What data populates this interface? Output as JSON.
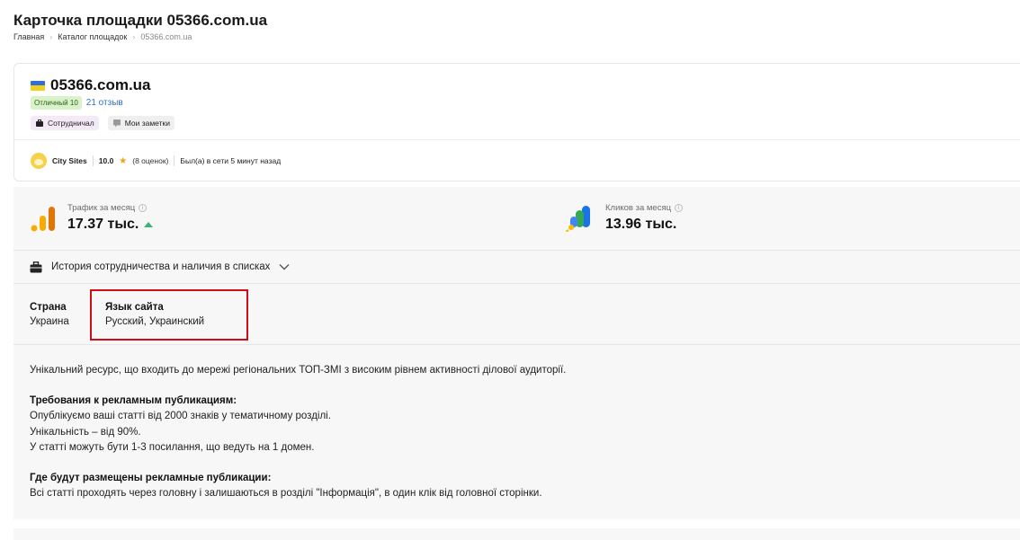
{
  "page": {
    "title": "Карточка площадки 05366.com.ua"
  },
  "breadcrumb": {
    "items": [
      "Главная",
      "Каталог площадок",
      "05366.com.ua"
    ]
  },
  "site": {
    "name": "05366.com.ua",
    "rating_badge": "Отличный 10",
    "reviews": "21 отзыв",
    "tags": {
      "collaborated": "Сотрудничал",
      "notes": "Мои заметки"
    },
    "owner": {
      "name": "City Sites",
      "score": "10.0",
      "votes": "(8 оценок)",
      "online": "Был(а) в сети 5 минут назад"
    }
  },
  "stats": {
    "traffic": {
      "label": "Трафик за месяц",
      "value": "17.37 тыс."
    },
    "clicks": {
      "label": "Кликов за месяц",
      "value": "13.96 тыс."
    }
  },
  "history": {
    "label": "История сотрудничества и наличия в списках"
  },
  "props": {
    "country": {
      "key": "Страна",
      "value": "Украина"
    },
    "language": {
      "key": "Язык сайта",
      "value": "Русский, Украинский"
    }
  },
  "description": {
    "intro": "Унікальний ресурс, що входить до мережі регіональних ТОП-ЗМІ з високим рівнем активності ділової аудиторії.",
    "requirements_heading": "Требования к рекламным публикациям:",
    "requirements": [
      "Опублікуємо ваші статті від 2000 знаків у тематичному розділі.",
      "Унікальність – від 90%.",
      "У статті можуть бути 1-3 посилання, що ведуть на 1 домен."
    ],
    "placement_heading": "Где будут размещены рекламные публикации:",
    "placement": "Всі статті проходять через головну і залишаються в розділі \"Інформація\", в один клік від головної сторінки."
  },
  "colors": {
    "accent_link": "#2f6fd6",
    "highlight": "#d10c16",
    "rating_badge_bg": "#d9f2c9",
    "trend_up": "#3cb371"
  },
  "icons": [
    "ukraine-flag-icon",
    "briefcase-icon",
    "notes-icon",
    "info-icon",
    "chevron-down-icon",
    "traffic-bars-icon",
    "google-ads-icon",
    "owner-avatar-icon",
    "star-icon",
    "trend-up-icon"
  ]
}
